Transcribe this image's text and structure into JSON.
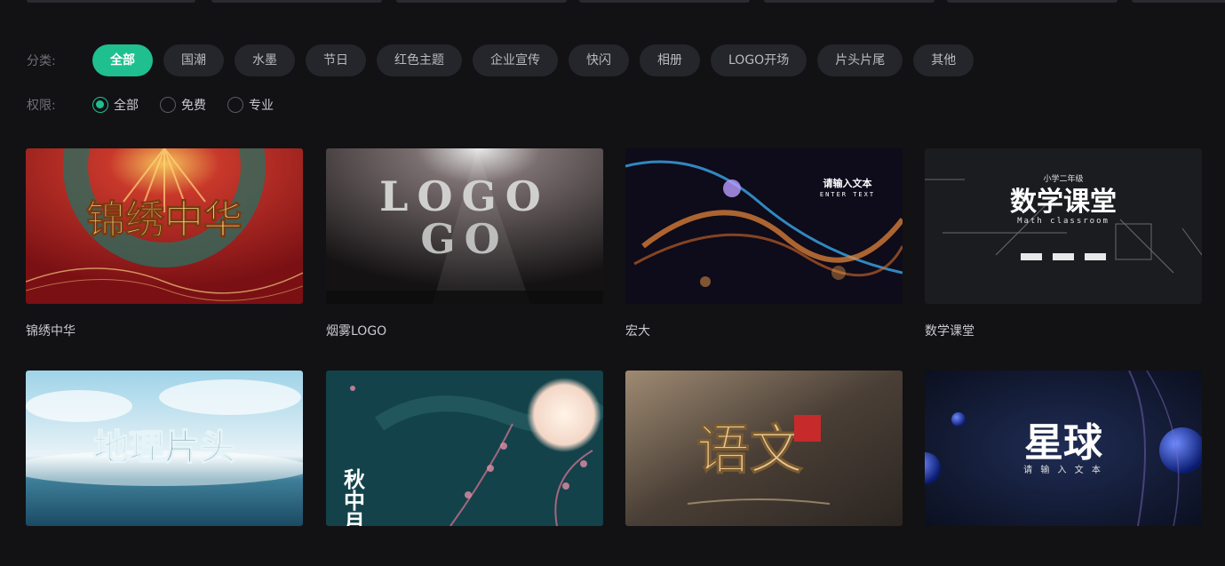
{
  "filters": {
    "category_label": "分类:",
    "categories": [
      "全部",
      "国潮",
      "水墨",
      "节日",
      "红色主题",
      "企业宣传",
      "快闪",
      "相册",
      "LOGO开场",
      "片头片尾",
      "其他"
    ],
    "selected_category": "全部",
    "permission_label": "权限:",
    "permissions": [
      "全部",
      "免费",
      "专业"
    ],
    "selected_permission": "全部"
  },
  "templates": [
    {
      "title": "锦绣中华",
      "thumb_text": "锦绣中华"
    },
    {
      "title": "烟雾LOGO",
      "thumb_text": "LOGO"
    },
    {
      "title": "宏大",
      "thumb_text": "请输入文本"
    },
    {
      "title": "数学课堂",
      "thumb_text": "数学课堂"
    },
    {
      "title": "",
      "thumb_text": "地理片头"
    },
    {
      "title": "",
      "thumb_text": "秋中月"
    },
    {
      "title": "",
      "thumb_text": "语文"
    },
    {
      "title": "",
      "thumb_text": "星球"
    }
  ],
  "colors": {
    "accent": "#1fbf8f",
    "background": "#121214",
    "chip": "#25262b"
  }
}
